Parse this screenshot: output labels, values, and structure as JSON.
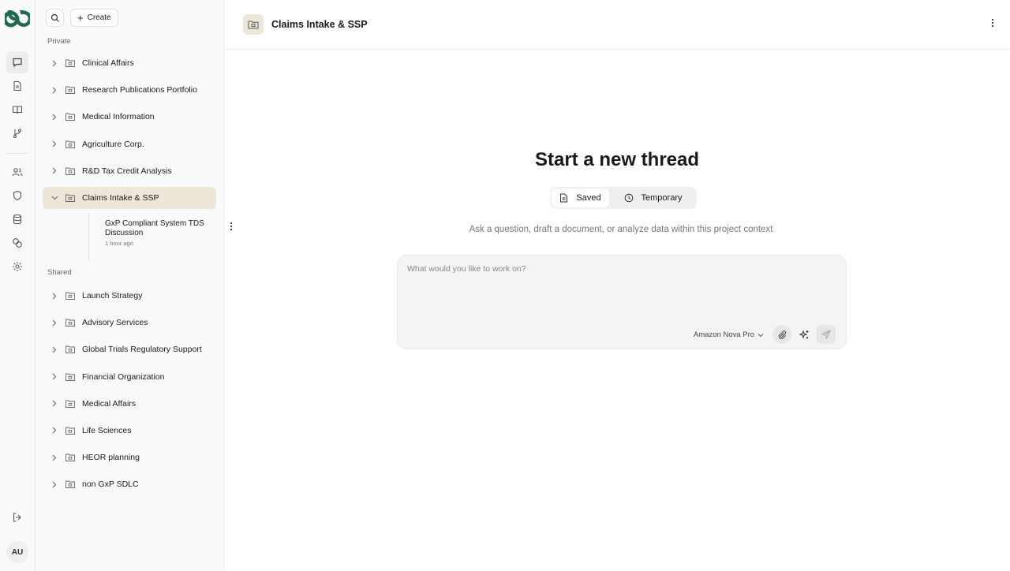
{
  "rail": {
    "logo": "copilot-logo",
    "items": [
      "chat-icon",
      "document-icon",
      "book-icon",
      "git-branch-icon",
      "users-icon",
      "shield-icon",
      "database-icon",
      "coins-icon",
      "gear-icon"
    ],
    "logout": "logout-icon",
    "avatar": "AU"
  },
  "sidebar": {
    "create_label": "Create",
    "private_label": "Private",
    "shared_label": "Shared",
    "private_folders": [
      "Clinical Affairs",
      "Research Publications Portfolio",
      "Medical Information",
      "Agriculture Corp.",
      "R&D Tax Credit Analysis",
      "Claims Intake & SSP"
    ],
    "active_folder": "Claims Intake & SSP",
    "thread": {
      "title": "GxP Compliant System TDS Discussion",
      "time": "1 hour ago"
    },
    "shared_folders": [
      "Launch Strategy",
      "Advisory Services",
      "Global Trials Regulatory Support",
      "Financial Organization",
      "Medical Affairs",
      "Life Sciences",
      "HEOR planning",
      "non GxP SDLC"
    ]
  },
  "header": {
    "title": "Claims Intake & SSP"
  },
  "main": {
    "hero_title": "Start a new thread",
    "toggle": {
      "saved": "Saved",
      "temporary": "Temporary",
      "selected": "Saved"
    },
    "subtitle": "Ask a question, draft a document, or analyze data within this project context",
    "composer": {
      "placeholder": "What would you like to work on?",
      "value": "",
      "model": "Amazon Nova Pro"
    }
  },
  "colors": {
    "active_bg": "#efe6da",
    "brand": "#1f6b52"
  }
}
